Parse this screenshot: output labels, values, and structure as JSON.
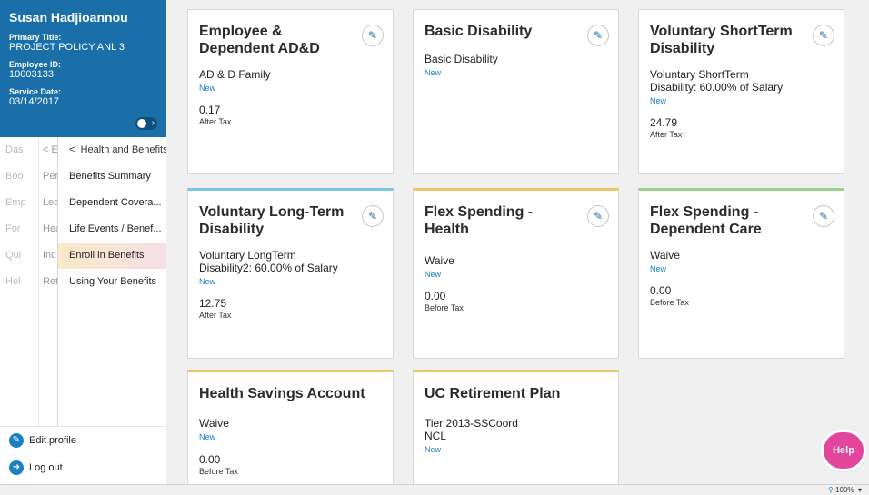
{
  "profile": {
    "name": "Susan Hadjioannou",
    "primary_title_label": "Primary Title:",
    "primary_title": "PROJECT POLICY ANL 3",
    "employee_id_label": "Employee ID:",
    "employee_id": "10003133",
    "service_date_label": "Service Date:",
    "service_date": "03/14/2017"
  },
  "nav": {
    "col1": [
      "Das",
      "Boo",
      "Emp",
      "For",
      "Qui",
      "Hel"
    ],
    "col2": [
      "<  E",
      "Per",
      "Lea",
      "Hea",
      "Inc",
      "Ret"
    ],
    "col3_header": "Health and Benefits",
    "col3": [
      "Benefits Summary",
      "Dependent Covera...",
      "Life Events / Benef...",
      "Enroll in Benefits",
      "Using Your Benefits"
    ],
    "back_glyph": "<"
  },
  "bottom_links": {
    "edit_profile": "Edit profile",
    "log_out": "Log out"
  },
  "cards": [
    {
      "title": "Employee & Dependent AD&D",
      "plan": "AD & D Family",
      "status": "New",
      "amount": "0.17",
      "tax": "After Tax"
    },
    {
      "title": "Basic Disability",
      "plan": "Basic Disability",
      "status": "New",
      "amount": "",
      "tax": ""
    },
    {
      "title": "Voluntary ShortTerm Disability",
      "plan": "Voluntary ShortTerm Disability: 60.00% of Salary",
      "status": "New",
      "amount": "24.79",
      "tax": "After Tax"
    },
    {
      "title": "Voluntary Long-Term Disability",
      "plan": "Voluntary LongTerm Disability2: 60.00% of Salary",
      "status": "New",
      "amount": "12.75",
      "tax": "After Tax"
    },
    {
      "title": "Flex Spending - Health",
      "plan": "Waive",
      "status": "New",
      "amount": "0.00",
      "tax": "Before Tax"
    },
    {
      "title": "Flex Spending - Dependent Care",
      "plan": "Waive",
      "status": "New",
      "amount": "0.00",
      "tax": "Before Tax"
    },
    {
      "title": "Health Savings Account",
      "plan": "Waive",
      "status": "New",
      "amount": "0.00",
      "tax": "Before Tax"
    },
    {
      "title": "UC Retirement Plan",
      "plan": "Tier 2013-SSCoord NCL",
      "status": "New",
      "amount": "",
      "tax": ""
    }
  ],
  "help_label": "Help",
  "statusbar": {
    "zoom": "100%"
  },
  "icons": {
    "edit": "pencil-icon",
    "profile_edit": "pencil-circle-icon",
    "logout": "logout-icon",
    "zoom": "magnifier-icon",
    "help": "help-button"
  },
  "colors": {
    "profile_bg": "#1b6fa8",
    "accent": "#1b7fc4",
    "help": "#e2459c",
    "gold_bar": "#e9c56a"
  }
}
